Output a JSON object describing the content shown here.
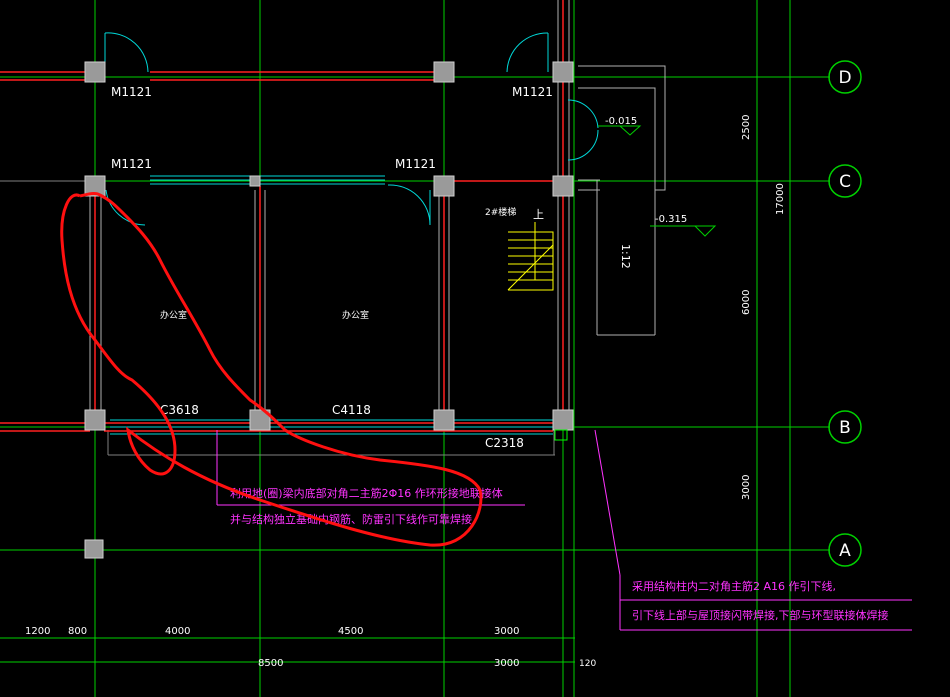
{
  "colors": {
    "background": "#000000",
    "grid": "#00ff00",
    "wall": "#c8c8c8",
    "beam": "#ff3030",
    "window": "#00e0e0",
    "door": "#00e0e0",
    "column": "#a0a0a0",
    "annotation": "#ff33ff",
    "stair": "#ffff00",
    "markup": "#ff0000"
  },
  "doors": {
    "d1": "M1121",
    "d2": "M1121",
    "d3": "M1121",
    "d4": "M1121"
  },
  "windows": {
    "w1": "C3618",
    "w2": "C4118",
    "w3": "C2318"
  },
  "rooms": {
    "r1": "办公室",
    "r2": "办公室"
  },
  "stair": {
    "name": "2#楼梯",
    "up": "上"
  },
  "levels": {
    "l1": "-0.015",
    "l2": "-0.315"
  },
  "ramp": {
    "slope": "1:12"
  },
  "axes": {
    "a": "A",
    "b": "B",
    "c": "C",
    "d": "D"
  },
  "dims_right": {
    "dc": "2500",
    "cb": "6000",
    "ba": "3000",
    "total": "17000"
  },
  "dims_bottom": {
    "d1": "1200",
    "d2": "800",
    "d3": "4000",
    "d4": "4500",
    "d5": "3000",
    "total1": "8500",
    "total2": "3000",
    "small": "120"
  },
  "note1": {
    "line1": "利用地(圈)梁内底部对角二主筋2Φ16 作环形接地联接体",
    "line2": "并与结构独立基础内钢筋、防雷引下线作可靠焊接"
  },
  "note2": {
    "line1": "采用结构柱内二对角主筋2 A16 作引下线,",
    "line2": "引下线上部与屋顶接闪带焊接,下部与环型联接体焊接"
  }
}
